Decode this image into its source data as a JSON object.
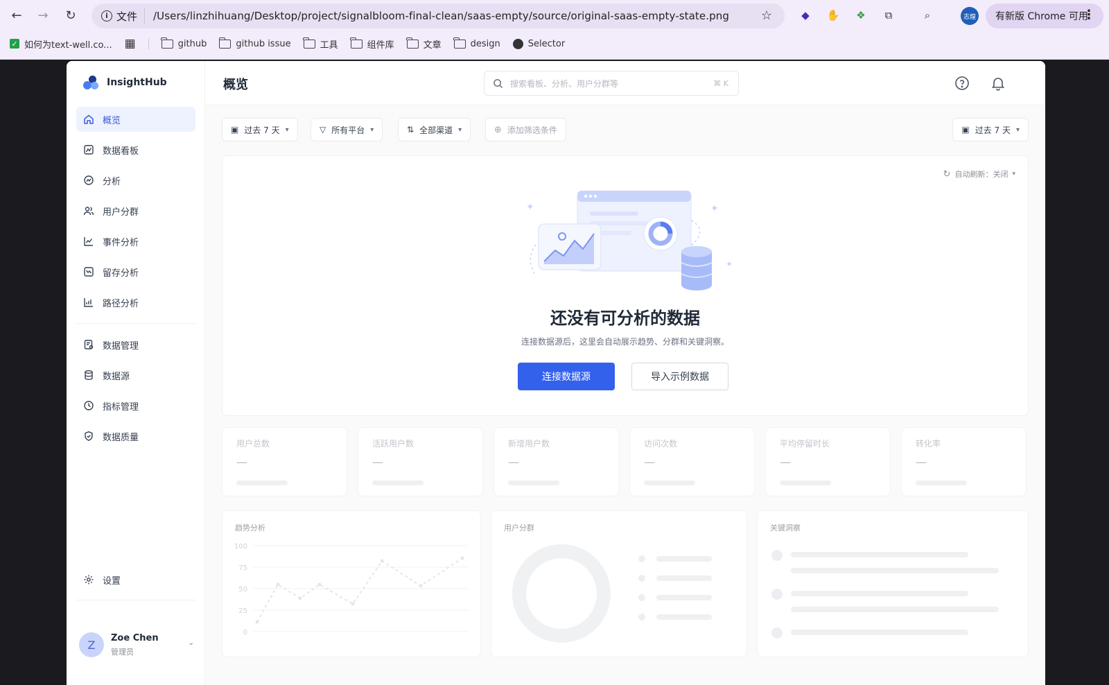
{
  "browser": {
    "url": "/Users/linzhihuang/Desktop/project/signalbloom-final-clean/saas-empty/source/original-saas-empty-state.png",
    "file_label": "文件",
    "profile_label": "志煌",
    "update_label": "有新版 Chrome 可用",
    "bookmarks": [
      {
        "label": "如何为text-well.co..."
      },
      {
        "label": "github"
      },
      {
        "label": "github issue"
      },
      {
        "label": "工具"
      },
      {
        "label": "组件库"
      },
      {
        "label": "文章"
      },
      {
        "label": "design"
      },
      {
        "label": "Selector"
      }
    ]
  },
  "app": {
    "name": "InsightHub",
    "sidebar": {
      "items": [
        {
          "label": "概览",
          "icon": "home-icon"
        },
        {
          "label": "数据看板",
          "icon": "dashboard-icon"
        },
        {
          "label": "分析",
          "icon": "analysis-icon"
        },
        {
          "label": "用户分群",
          "icon": "users-icon"
        },
        {
          "label": "事件分析",
          "icon": "event-chart-icon"
        },
        {
          "label": "留存分析",
          "icon": "retention-icon"
        },
        {
          "label": "路径分析",
          "icon": "path-icon"
        }
      ],
      "items2": [
        {
          "label": "数据管理",
          "icon": "data-manage-icon"
        },
        {
          "label": "数据源",
          "icon": "database-icon"
        },
        {
          "label": "指标管理",
          "icon": "metric-icon"
        },
        {
          "label": "数据质量",
          "icon": "shield-check-icon"
        }
      ],
      "settings_label": "设置",
      "user": {
        "initial": "Z",
        "name": "Zoe Chen",
        "role": "管理员"
      }
    },
    "header": {
      "title": "概览",
      "search_placeholder": "搜索看板、分析、用户分群等",
      "search_shortcut": "⌘ K"
    },
    "filters": {
      "date": "过去 7 天",
      "platform": "所有平台",
      "channel": "全部渠道",
      "add": "添加筛选条件",
      "date_right": "过去 7 天"
    },
    "empty_state": {
      "auto_refresh": "自动刷新：关闭",
      "title": "还没有可分析的数据",
      "description": "连接数据源后，这里会自动展示趋势、分群和关键洞察。",
      "primary_button": "连接数据源",
      "secondary_button": "导入示例数据"
    },
    "metrics": [
      {
        "label": "用户总数",
        "value": "—"
      },
      {
        "label": "活跃用户数",
        "value": "—"
      },
      {
        "label": "新增用户数",
        "value": "—"
      },
      {
        "label": "访问次数",
        "value": "—"
      },
      {
        "label": "平均停留时长",
        "value": "—"
      },
      {
        "label": "转化率",
        "value": "—"
      }
    ],
    "panels": {
      "trend": "趋势分析",
      "segments": "用户分群",
      "insights": "关键洞察"
    },
    "trend_axis": [
      "100",
      "75",
      "50",
      "25",
      "0"
    ]
  },
  "colors": {
    "accent": "#3461ec",
    "active_bg": "#eef2ff"
  }
}
